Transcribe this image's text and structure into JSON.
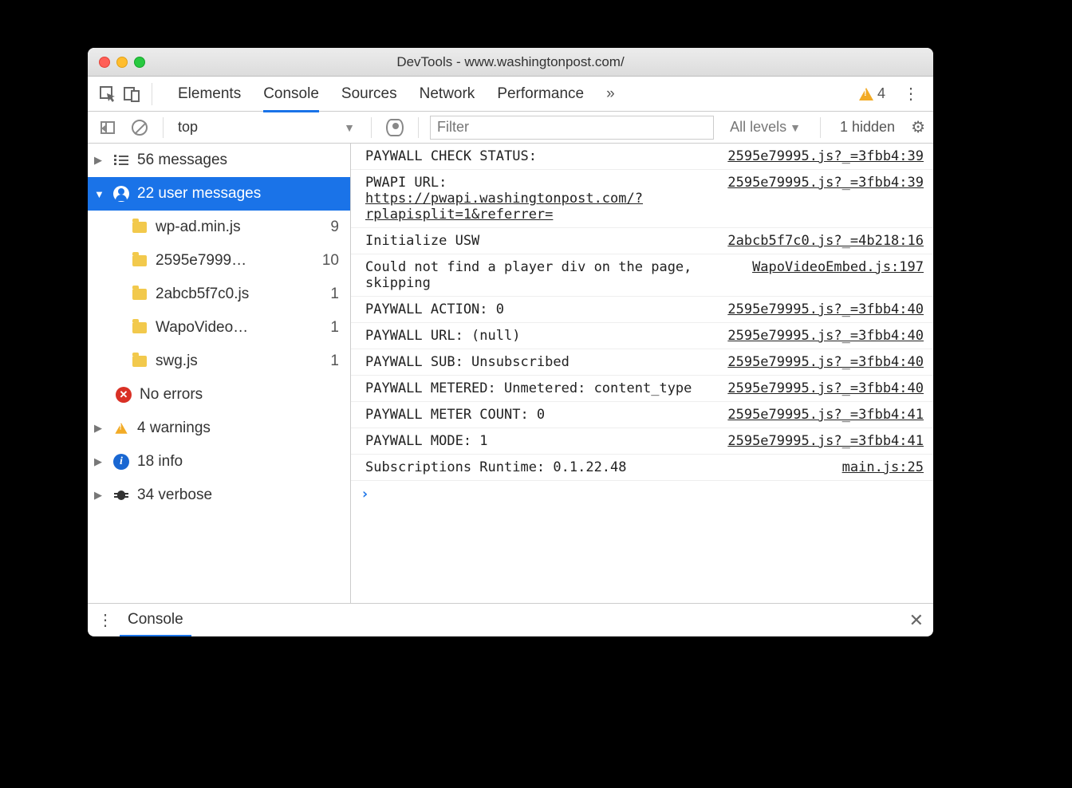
{
  "window": {
    "title": "DevTools - www.washingtonpost.com/"
  },
  "tabs": {
    "items": [
      "Elements",
      "Console",
      "Sources",
      "Network",
      "Performance"
    ],
    "active": "Console",
    "more_glyph": "»",
    "warning_count": "4"
  },
  "toolbar": {
    "context": "top",
    "filter_placeholder": "Filter",
    "levels_label": "All levels",
    "hidden_label": "1 hidden"
  },
  "sidebar": {
    "messages": {
      "label": "56 messages"
    },
    "user_messages": {
      "label": "22 user messages"
    },
    "files": [
      {
        "name": "wp-ad.min.js",
        "count": "9"
      },
      {
        "name": "2595e7999…",
        "count": "10"
      },
      {
        "name": "2abcb5f7c0.js",
        "count": "1"
      },
      {
        "name": "WapoVideo…",
        "count": "1"
      },
      {
        "name": "swg.js",
        "count": "1"
      }
    ],
    "errors": {
      "label": "No errors"
    },
    "warnings": {
      "label": "4 warnings"
    },
    "info": {
      "label": "18 info"
    },
    "verbose": {
      "label": "34 verbose"
    }
  },
  "logs": [
    {
      "msg": "PAYWALL CHECK STATUS:",
      "link": "2595e79995.js?_=3fbb4:39"
    },
    {
      "msg": "PWAPI URL: https://pwapi.washingtonpost.com/?rplapisplit=1&referrer=",
      "msg_link_from": 11,
      "link": "2595e79995.js?_=3fbb4:39"
    },
    {
      "msg": "Initialize USW",
      "link": "2abcb5f7c0.js?_=4b218:16"
    },
    {
      "msg": "Could not find a player div on the page, skipping",
      "link": "WapoVideoEmbed.js:197"
    },
    {
      "msg": "PAYWALL ACTION: 0",
      "link": "2595e79995.js?_=3fbb4:40"
    },
    {
      "msg": "PAYWALL URL: (null)",
      "link": "2595e79995.js?_=3fbb4:40"
    },
    {
      "msg": "PAYWALL SUB: Unsubscribed",
      "link": "2595e79995.js?_=3fbb4:40"
    },
    {
      "msg": "PAYWALL METERED: Unmetered: content_type",
      "link": "2595e79995.js?_=3fbb4:40"
    },
    {
      "msg": "PAYWALL METER COUNT: 0",
      "link": "2595e79995.js?_=3fbb4:41"
    },
    {
      "msg": "PAYWALL MODE: 1",
      "link": "2595e79995.js?_=3fbb4:41"
    },
    {
      "msg": "Subscriptions Runtime: 0.1.22.48",
      "link": "main.js:25"
    }
  ],
  "drawer": {
    "tab": "Console"
  }
}
